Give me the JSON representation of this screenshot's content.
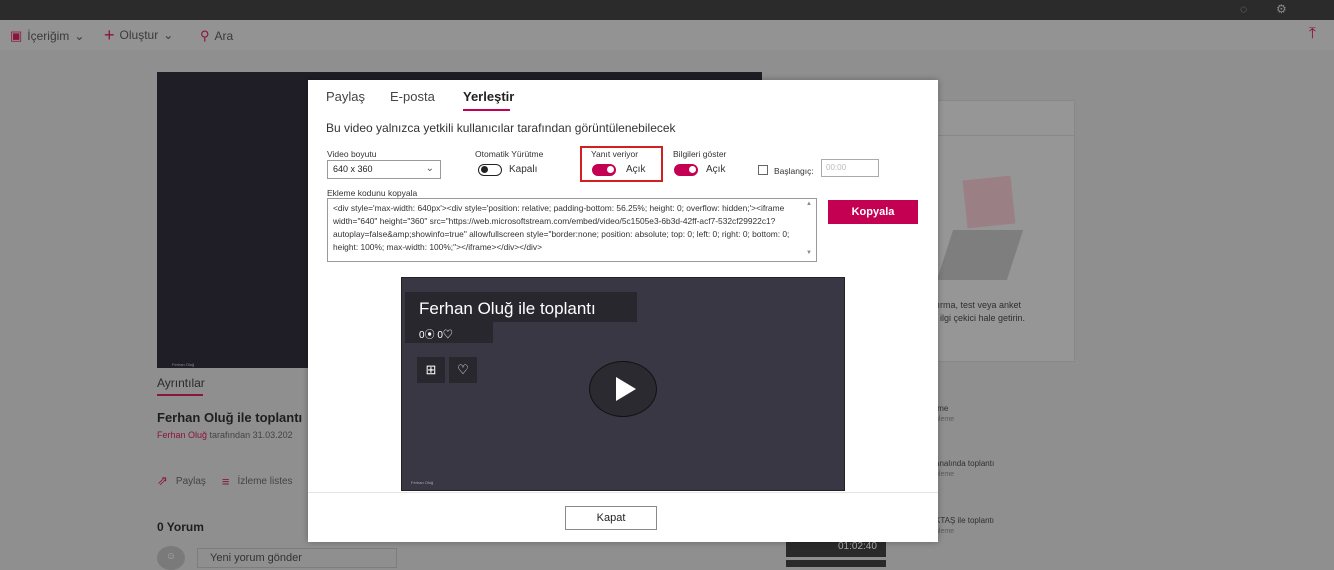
{
  "command_bar": {
    "my_content": "İçeriğim",
    "create": "Oluştur",
    "search": "Ara"
  },
  "page": {
    "hero_name": "Ferhan Oluğ",
    "details_tab": "Ayrıntılar",
    "title": "Ferhan Oluğ ile toplantı",
    "byline_author": "Ferhan Oluğ",
    "byline_rest": "tarafından 31.03.202",
    "share": "Paylaş",
    "watchlist": "İzleme listes",
    "comments": "0 Yorum",
    "new_comment": "Yeni yorum gönder"
  },
  "right_panel": {
    "card_line1": "tırma, test veya anket",
    "card_line2": "ı ilgi çekici hale getirin.",
    "items": [
      {
        "title": "ıme",
        "sub": "üleme"
      },
      {
        "title": "analında toplantı",
        "sub": "üleme"
      },
      {
        "title": "KTAŞ ile toplantı",
        "sub": "üleme"
      }
    ],
    "thumb_duration": "01:02:40"
  },
  "modal": {
    "tabs": [
      "Paylaş",
      "E-posta",
      "Yerleştir"
    ],
    "active_tab": "Yerleştir",
    "notice": "Bu video yalnızca yetkili kullanıcılar tarafından görüntülenebilecek",
    "video_size_label": "Video boyutu",
    "video_size_value": "640 x 360",
    "autoplay_label": "Otomatik Yürütme",
    "autoplay_value": "Kapalı",
    "responsive_label": "Yanıt veriyor",
    "responsive_value": "Açık",
    "showinfo_label": "Bilgileri göster",
    "showinfo_value": "Açık",
    "start_label": "Başlangıç:",
    "start_placeholder": "00:00",
    "embed_label": "Ekleme kodunu kopyala",
    "embed_code": "<div style='max-width: 640px'><div style='position: relative; padding-bottom: 56.25%; height: 0; overflow: hidden;'><iframe width=\"640\" height=\"360\" src=\"https://web.microsoftstream.com/embed/video/5c1505e3-6b3d-42ff-acf7-532cf29922c1?autoplay=false&amp;showinfo=true\" allowfullscreen style=\"border:none; position: absolute; top: 0; left: 0; right: 0; bottom: 0; height: 100%; max-width: 100%;\"></iframe></div></div>",
    "copy_button": "Kopyala",
    "close_button": "Kapat"
  },
  "player": {
    "title": "Ferhan Oluğ ile toplantı",
    "views": "0",
    "likes": "0",
    "watermark": "FO",
    "owner_name": "Ferhan Oluğ"
  },
  "colors": {
    "accent": "#c30052",
    "brand": "#8a1538",
    "highlight_box": "#d21f1f"
  }
}
